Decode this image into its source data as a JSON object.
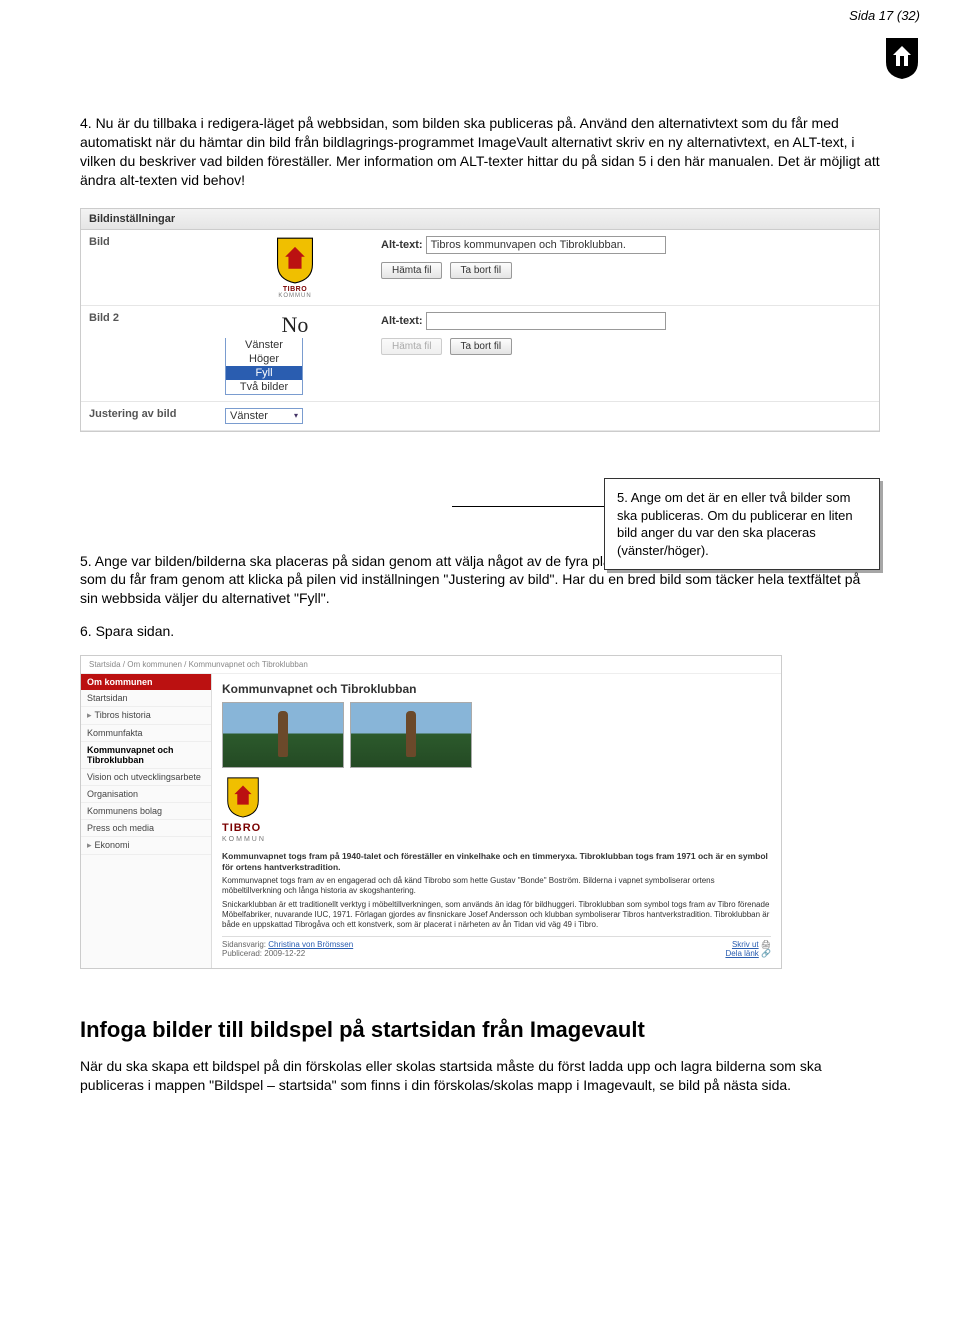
{
  "page_number": "Sida 17 (32)",
  "intro_p1": "4. Nu är du tillbaka i redigera-läget på webbsidan, som bilden ska publiceras på. Använd den alternativtext som du får med automatiskt när du hämtar din bild från bildlagrings-programmet ImageVault alternativt skriv en ny alternativtext, en ALT-text, i vilken du beskriver vad bilden föreställer. Mer information om ALT-texter hittar du på sidan 5 i den här manualen. Det är möjligt att ändra alt-texten vid behov!",
  "panel1": {
    "header": "Bildinställningar",
    "row_bild": "Bild",
    "row_bild2": "Bild 2",
    "row_just": "Justering av bild",
    "alt_label": "Alt-text:",
    "alt_value": "Tibros kommunvapen och Tibroklubban.",
    "btn_fetch": "Hämta fil",
    "btn_remove": "Ta bort fil",
    "noimg": "No",
    "options": [
      "Vänster",
      "Höger",
      "Fyll",
      "Två bilder"
    ],
    "selected_option": "Fyll",
    "just_value": "Vänster",
    "tibro": "TIBRO",
    "tibro_sub": "KOMMUN"
  },
  "callout": "5. Ange om det är en eller två bilder som ska publiceras. Om du publicerar en liten bild anger du var den ska placeras (vänster/höger).",
  "p2": "5. Ange var bilden/bilderna ska placeras på sidan genom att välja något av de fyra placeringsalternativen i dropdown-menyn, som du får fram genom att klicka på pilen vid inställningen \"Justering av bild\". Har du en bred bild som täcker hela textfältet på sin webbsida väljer du alternativet \"Fyll\".",
  "p3": "6. Spara sidan.",
  "preview": {
    "breadcrumb": "Startsida / Om kommunen / Kommunvapnet och Tibroklubban",
    "side_header": "Om kommunen",
    "side_items": [
      "Startsidan",
      "Tibros historia",
      "Kommunfakta",
      "Kommunvapnet och Tibroklubban",
      "Vision och utvecklingsarbete",
      "Organisation",
      "Kommunens bolag",
      "Press och media",
      "Ekonomi"
    ],
    "active_index": 3,
    "expandable": [
      1,
      8
    ],
    "title": "Kommunvapnet och Tibroklubban",
    "tibro": "TIBRO",
    "tibro_sub": "KOMMUN",
    "caption": "Kommunvapnet togs fram på 1940-talet och föreställer en vinkelhake och en timmeryxa. Tibroklubban togs fram 1971 och är en symbol för ortens hantverkstradition.",
    "para1": "Kommunvapnet togs fram av en engagerad och då känd Tibrobo som hette Gustav \"Bonde\" Boström. Bilderna i vapnet symboliserar ortens möbeltillverkning och långa historia av skogshantering.",
    "para2": "Snickarklubban är ett traditionellt verktyg i möbeltillverkningen, som används än idag för bildhuggeri. Tibroklubban som symbol togs fram av Tibro förenade Möbelfabriker, nuvarande IUC, 1971. Förlagan gjordes av finsnickare Josef Andersson och klubban symboliserar Tibros hantverkstradition. Tibroklubban är både en uppskattad Tibrogåva och ett konstverk, som är placerat i närheten av ån Tidan vid väg 49 i Tibro.",
    "resp_label": "Sidansvarig:",
    "resp_name": "Christina von Brömssen",
    "pub_label": "Publicerad:",
    "pub_date": "2009-12-22",
    "print": "Skriv ut",
    "share": "Dela länk"
  },
  "section_title": "Infoga bilder till bildspel på startsidan från Imagevault",
  "p4": "När du ska skapa ett bildspel på din förskolas eller skolas startsida måste du först ladda upp och lagra bilderna som ska publiceras i mappen \"Bildspel – startsida\" som finns i din förskolas/skolas mapp i Imagevault, se bild på nästa sida."
}
